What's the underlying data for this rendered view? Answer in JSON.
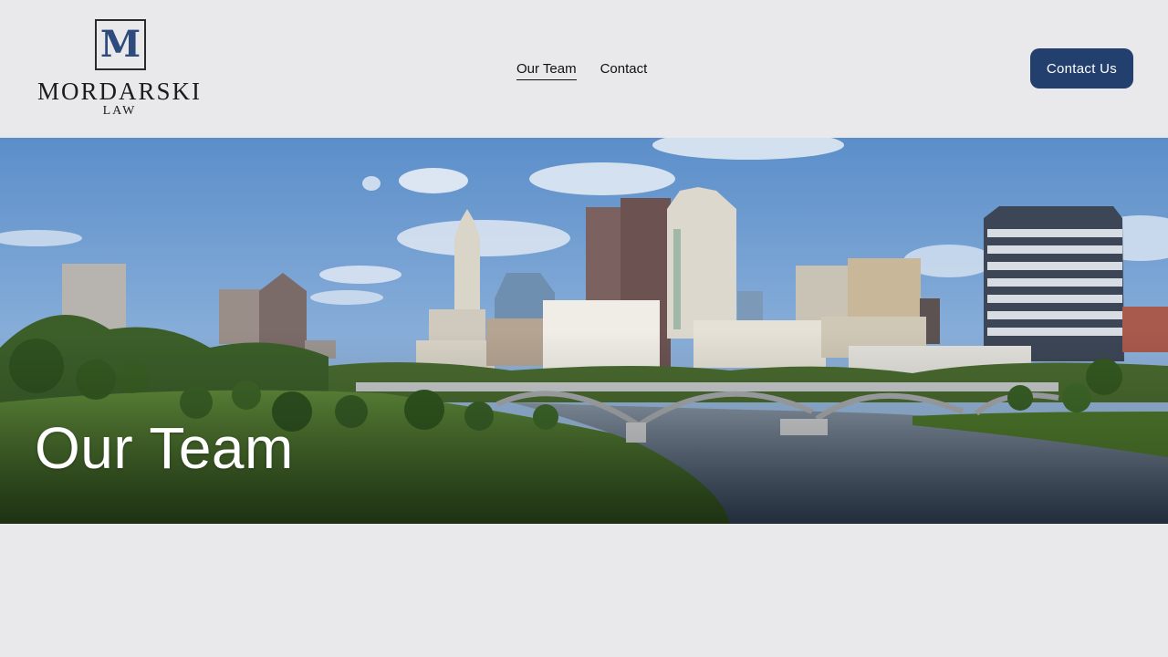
{
  "logo": {
    "monogram": "M",
    "name": "MORDARSKI",
    "subtitle": "LAW"
  },
  "nav": {
    "items": [
      {
        "label": "Our Team",
        "active": true
      },
      {
        "label": "Contact",
        "active": false
      }
    ]
  },
  "header": {
    "cta_label": "Contact Us"
  },
  "hero": {
    "title": "Our Team"
  },
  "colors": {
    "page_background": "#e9e9ec",
    "accent": "#223f6e",
    "monogram": "#2f4a7d"
  }
}
